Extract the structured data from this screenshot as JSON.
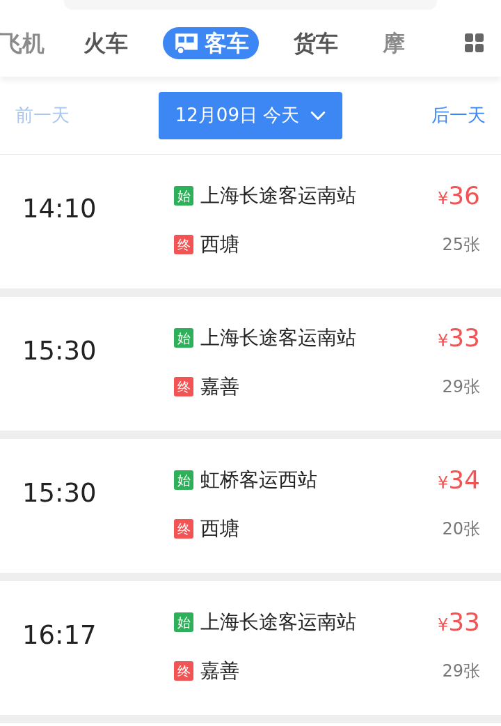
{
  "tabs": [
    {
      "label": "飞机",
      "selected": false
    },
    {
      "label": "火车",
      "selected": false
    },
    {
      "label": "客车",
      "selected": true
    },
    {
      "label": "货车",
      "selected": false
    },
    {
      "label": "摩",
      "selected": false
    }
  ],
  "date_bar": {
    "prev": "前一天",
    "date": "12月09日 今天",
    "next": "后一天"
  },
  "trips": [
    {
      "time": "14:10",
      "start_tag": "始",
      "start": "上海长途客运南站",
      "end_tag": "终",
      "end": "西塘",
      "price_symbol": "¥",
      "price": "36",
      "seats": "25张"
    },
    {
      "time": "15:30",
      "start_tag": "始",
      "start": "上海长途客运南站",
      "end_tag": "终",
      "end": "嘉善",
      "price_symbol": "¥",
      "price": "33",
      "seats": "29张"
    },
    {
      "time": "15:30",
      "start_tag": "始",
      "start": "虹桥客运西站",
      "end_tag": "终",
      "end": "西塘",
      "price_symbol": "¥",
      "price": "34",
      "seats": "20张"
    },
    {
      "time": "16:17",
      "start_tag": "始",
      "start": "上海长途客运南站",
      "end_tag": "终",
      "end": "嘉善",
      "price_symbol": "¥",
      "price": "33",
      "seats": "29张"
    }
  ]
}
